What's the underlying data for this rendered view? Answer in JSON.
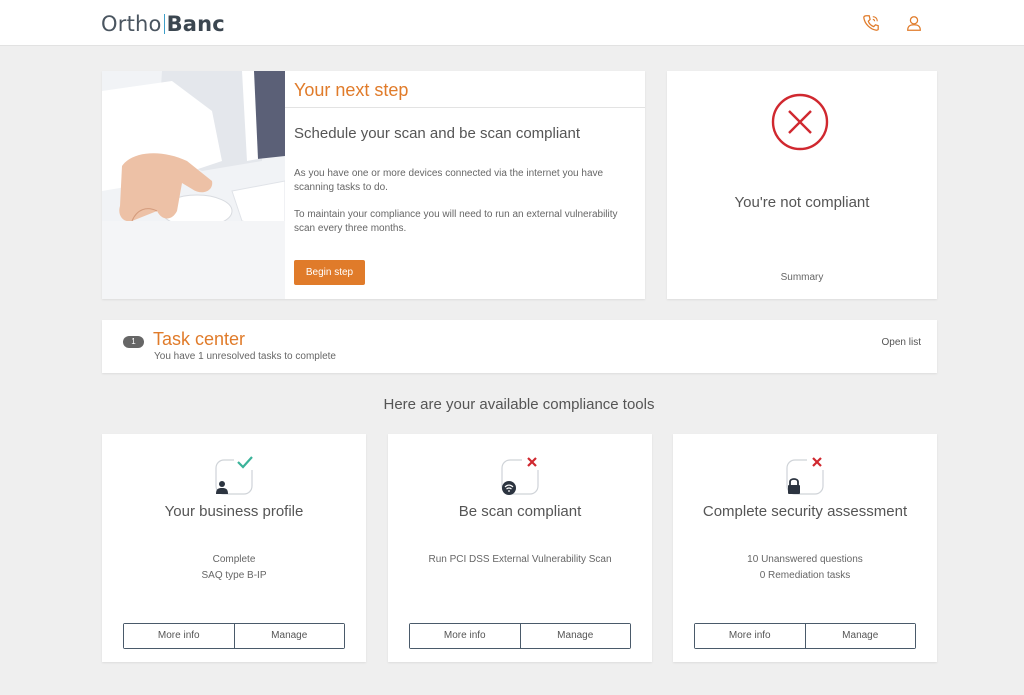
{
  "header": {
    "logo_part1": "Ortho",
    "logo_part2": "Banc",
    "phone_icon": "phone-icon",
    "user_icon": "user-icon"
  },
  "next_step": {
    "title": "Your next step",
    "heading": "Schedule your scan and be scan compliant",
    "paragraph1": "As you have one or more devices connected via the internet you have scanning tasks to do.",
    "paragraph2": "To maintain your compliance you will need to run an external vulnerability scan every three months.",
    "button_label": "Begin step"
  },
  "compliance_status": {
    "icon": "circle-x-icon",
    "text": "You're not compliant",
    "summary_link": "Summary"
  },
  "task_center": {
    "badge_count": "1",
    "title": "Task center",
    "subtitle": "You have 1 unresolved tasks to complete",
    "open_list_label": "Open list"
  },
  "tools_heading": "Here are your available compliance tools",
  "tools": [
    {
      "title": "Your business profile",
      "status_icon": "check-icon",
      "icon": "person-icon",
      "details": [
        "Complete",
        "SAQ type B-IP"
      ],
      "more_info_label": "More info",
      "manage_label": "Manage"
    },
    {
      "title": "Be scan compliant",
      "status_icon": "x-icon",
      "icon": "wifi-icon",
      "details": [
        "Run PCI DSS External Vulnerability Scan"
      ],
      "more_info_label": "More info",
      "manage_label": "Manage"
    },
    {
      "title": "Complete security assessment",
      "status_icon": "x-icon",
      "icon": "lock-icon",
      "details": [
        "10 Unanswered questions",
        "0 Remediation tasks"
      ],
      "more_info_label": "More info",
      "manage_label": "Manage"
    }
  ],
  "colors": {
    "accent_orange": "#e07b2a",
    "error_red": "#d0282f",
    "success_green": "#3bb39a",
    "logo_divider": "#3f9fc9"
  }
}
